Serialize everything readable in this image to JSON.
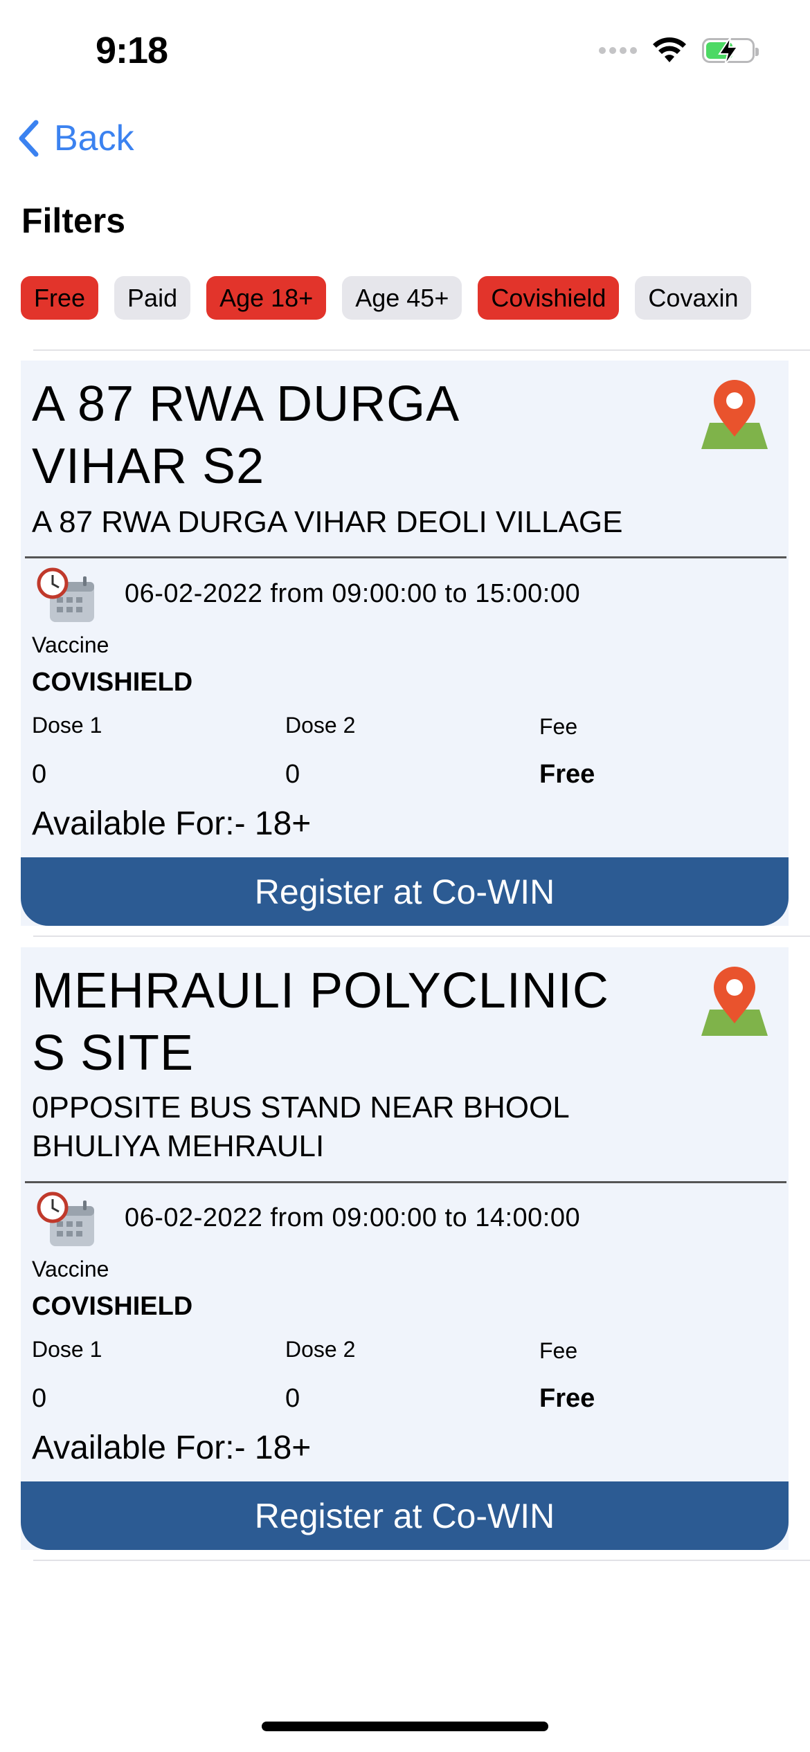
{
  "status_bar": {
    "time": "9:18"
  },
  "nav": {
    "back_label": "Back"
  },
  "filters": {
    "title": "Filters",
    "chips": [
      {
        "label": "Free",
        "active": true
      },
      {
        "label": "Paid",
        "active": false
      },
      {
        "label": "Age 18+",
        "active": true
      },
      {
        "label": "Age 45+",
        "active": false
      },
      {
        "label": "Covishield",
        "active": true
      },
      {
        "label": "Covaxin",
        "active": false
      }
    ]
  },
  "centers": [
    {
      "name": "A 87 RWA DURGA VIHAR S2",
      "address": "A 87 RWA DURGA VIHAR DEOLI VILLAGE",
      "session": "06-02-2022 from 09:00:00 to 15:00:00",
      "vaccine_label": "Vaccine",
      "vaccine": "COVISHIELD",
      "dose1_label": "Dose 1",
      "dose1": "0",
      "dose2_label": "Dose 2",
      "dose2": "0",
      "fee_label": "Fee",
      "fee": "Free",
      "available": "Available For:- 18+",
      "register_label": "Register at Co-WIN"
    },
    {
      "name": "MEHRAULI POLYCLINIC S SITE",
      "address": "0PPOSITE BUS STAND NEAR BHOOL BHULIYA MEHRAULI",
      "session": "06-02-2022 from 09:00:00 to 14:00:00",
      "vaccine_label": "Vaccine",
      "vaccine": "COVISHIELD",
      "dose1_label": "Dose 1",
      "dose1": "0",
      "dose2_label": "Dose 2",
      "dose2": "0",
      "fee_label": "Fee",
      "fee": "Free",
      "available": "Available For:- 18+",
      "register_label": "Register at Co-WIN"
    }
  ],
  "colors": {
    "accent_blue": "#3b82f0",
    "chip_active": "#e2342b",
    "chip_inactive": "#e6e6eb",
    "card_bg": "#f0f4fb",
    "register_bg": "#2c5b93"
  }
}
